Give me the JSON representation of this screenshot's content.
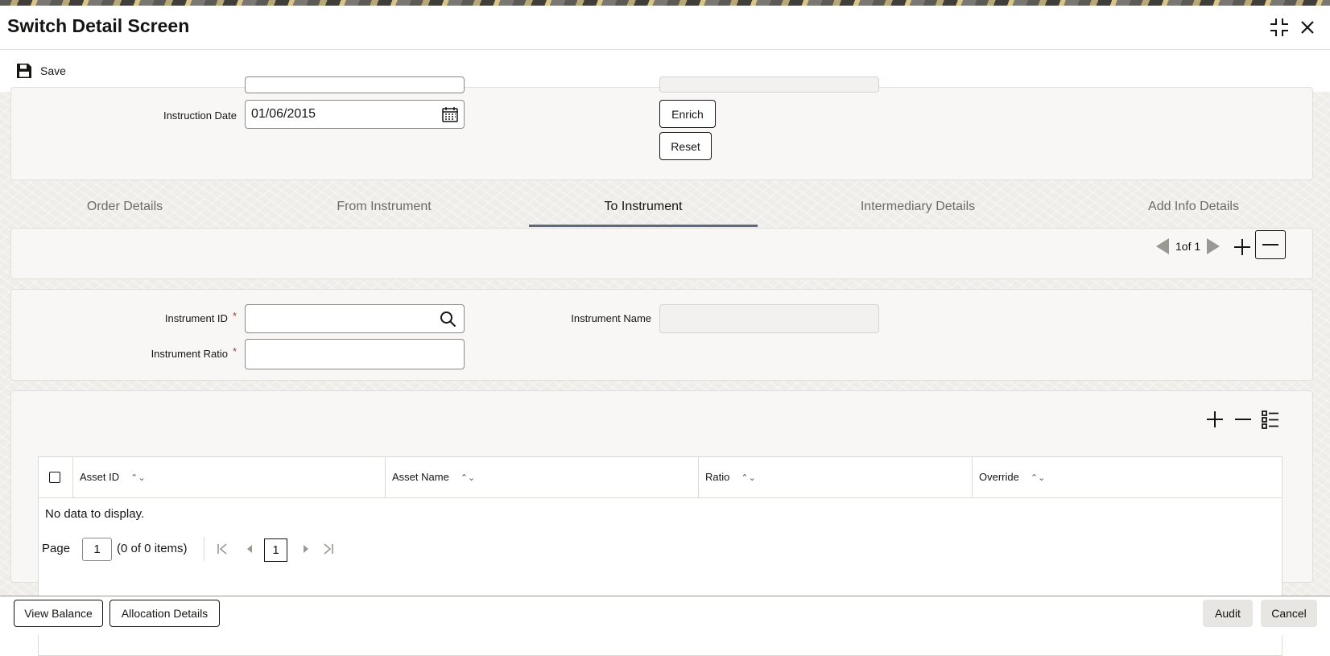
{
  "window": {
    "title": "Switch Detail Screen"
  },
  "toolbar": {
    "save_label": "Save"
  },
  "header_form": {
    "instruction_date_label": "Instruction Date",
    "instruction_date_value": "01/06/2015",
    "enrich_label": "Enrich",
    "reset_label": "Reset"
  },
  "tabs": [
    {
      "label": "Order Details"
    },
    {
      "label": "From Instrument"
    },
    {
      "label": "To Instrument",
      "active": true
    },
    {
      "label": "Intermediary Details"
    },
    {
      "label": "Add Info Details"
    }
  ],
  "record_nav": {
    "text": "1of 1"
  },
  "instrument_form": {
    "instrument_id_label": "Instrument ID",
    "instrument_id_value": "",
    "instrument_name_label": "Instrument Name",
    "instrument_name_value": "",
    "instrument_ratio_label": "Instrument Ratio",
    "instrument_ratio_value": "",
    "required_mark": "*"
  },
  "asset_grid": {
    "columns": [
      "Asset ID",
      "Asset Name",
      "Ratio",
      "Override"
    ],
    "empty_text": "No data to display.",
    "page_label": "Page",
    "page_value": "1",
    "items_text": "(0 of 0 items)",
    "current_page": "1"
  },
  "footer": {
    "view_balance": "View Balance",
    "allocation_details": "Allocation Details",
    "audit": "Audit",
    "cancel": "Cancel"
  },
  "colors": {
    "accent_underline": "#5b6a80",
    "required": "#b8351f"
  }
}
